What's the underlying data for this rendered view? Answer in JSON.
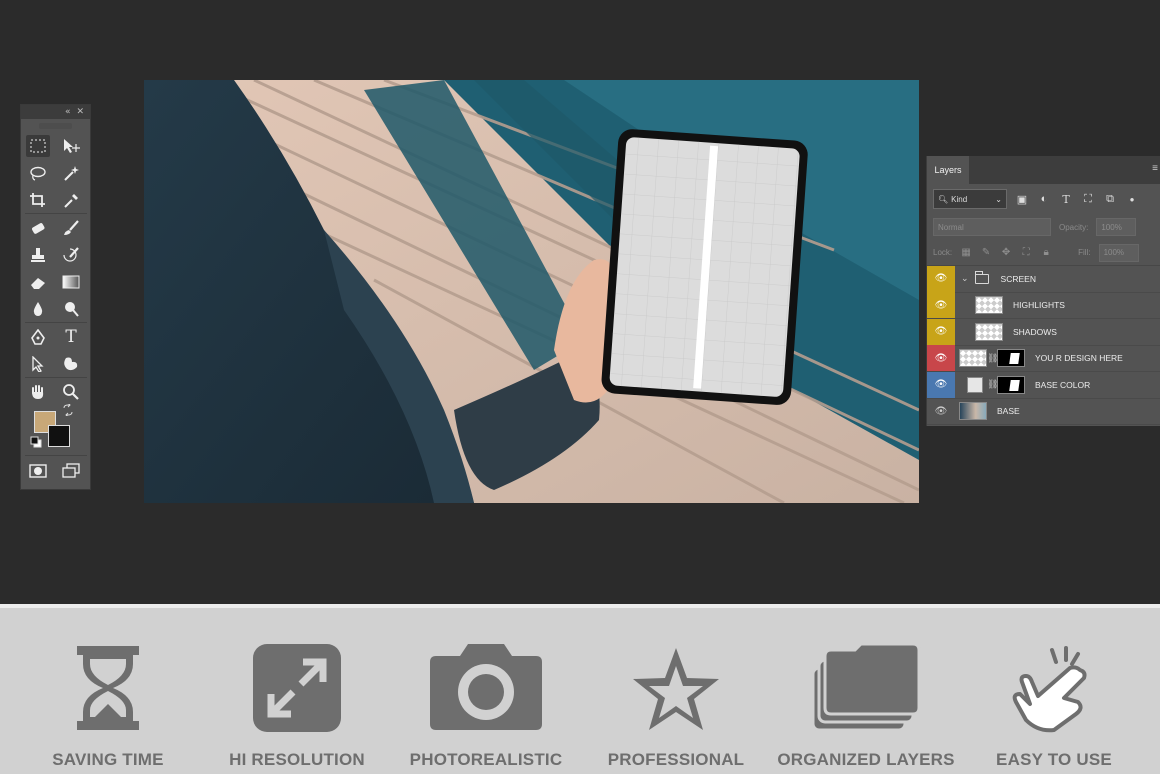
{
  "layers_panel": {
    "tab_label": "Layers",
    "kind_filter": "Kind",
    "blend_mode": "Normal",
    "opacity_label": "Opacity:",
    "opacity_value": "100%",
    "lock_label": "Lock:",
    "fill_label": "Fill:",
    "fill_value": "100%",
    "layers": [
      {
        "name": "SCREEN",
        "eye_color": "#c8a418"
      },
      {
        "name": "HIGHLIGHTS",
        "eye_color": "#c8a418"
      },
      {
        "name": "SHADOWS",
        "eye_color": "#c8a418"
      },
      {
        "name": "YOU R DESIGN HERE",
        "eye_color": "#c8464a"
      },
      {
        "name": "BASE COLOR",
        "eye_color": "#4a78b0"
      },
      {
        "name": "BASE",
        "eye_color": "none"
      }
    ]
  },
  "tools": {
    "foreground_color": "#c8a878",
    "background_color": "#111111",
    "icons": [
      "marquee-icon",
      "move-icon",
      "lasso-icon",
      "magic-wand-icon",
      "crop-icon",
      "eyedropper-icon",
      "healing-icon",
      "brush-icon",
      "stamp-icon",
      "history-brush-icon",
      "eraser-icon",
      "gradient-icon",
      "blur-icon",
      "dodge-icon",
      "pen-icon",
      "type-icon",
      "path-select-icon",
      "shape-icon",
      "hand-icon",
      "zoom-icon"
    ]
  },
  "features": [
    {
      "label": "SAVING TIME",
      "icon": "hourglass-icon"
    },
    {
      "label": "HI RESOLUTION",
      "icon": "expand-icon"
    },
    {
      "label": "PHOTOREALISTIC",
      "icon": "camera-icon"
    },
    {
      "label": "PROFESSIONAL",
      "icon": "star-icon"
    },
    {
      "label": "ORGANIZED LAYERS",
      "icon": "layers-icon"
    },
    {
      "label": "EASY TO USE",
      "icon": "hand-pointer-icon"
    }
  ]
}
